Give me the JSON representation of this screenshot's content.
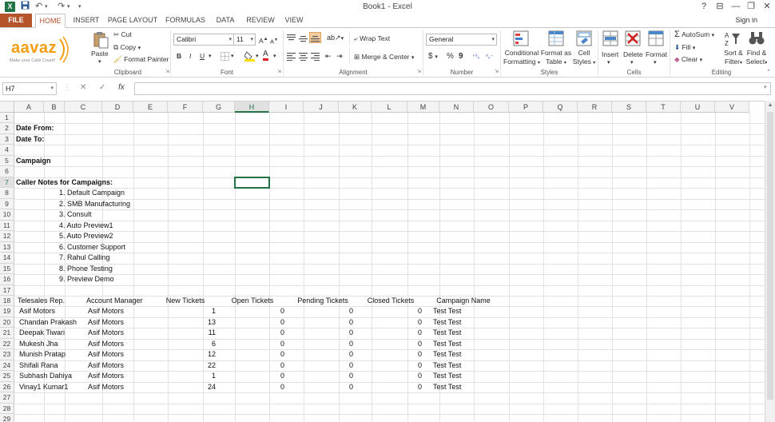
{
  "title_bar": {
    "app_logo": "X",
    "title": "Book1 - Excel",
    "help": "?",
    "restore_ribbon": "⊟",
    "minimize": "—",
    "maximize": "❐",
    "close": "✕"
  },
  "tabs": {
    "file": "FILE",
    "items": [
      "HOME",
      "INSERT",
      "PAGE LAYOUT",
      "FORMULAS",
      "DATA",
      "REVIEW",
      "VIEW"
    ],
    "active": "HOME",
    "sign_in": "Sign in"
  },
  "brand": {
    "logo_text": "aavaz",
    "tagline": "Make your Calls Count!"
  },
  "clipboard": {
    "paste": "Paste",
    "cut": "Cut",
    "copy": "Copy",
    "format_painter": "Format Painter",
    "group_label": "Clipboard"
  },
  "font": {
    "font_name": "Calibri",
    "font_size": "11",
    "bold": "B",
    "italic": "I",
    "underline": "U",
    "group_label": "Font"
  },
  "alignment": {
    "wrap_text": "Wrap Text",
    "merge_center": "Merge & Center",
    "group_label": "Alignment"
  },
  "number": {
    "format": "General",
    "currency": "$",
    "percent": "%",
    "comma": "9",
    "group_label": "Number"
  },
  "styles": {
    "conditional_formatting": [
      "Conditional",
      "Formatting"
    ],
    "format_as_table": [
      "Format as",
      "Table"
    ],
    "cell_styles": [
      "Cell",
      "Styles"
    ],
    "group_label": "Styles"
  },
  "cells": {
    "insert": "Insert",
    "delete": "Delete",
    "format": "Format",
    "group_label": "Cells"
  },
  "editing": {
    "autosum": "AutoSum",
    "fill": "Fill",
    "clear": "Clear",
    "sort_filter": [
      "Sort &",
      "Filter"
    ],
    "find_select": [
      "Find &",
      "Select"
    ],
    "group_label": "Editing"
  },
  "formula_bar": {
    "name_box": "H7",
    "cancel": "✕",
    "enter": "✓",
    "fx": "fx",
    "value": ""
  },
  "sheet": {
    "columns": [
      "A",
      "B",
      "C",
      "D",
      "E",
      "F",
      "G",
      "H",
      "I",
      "J",
      "K",
      "L",
      "M",
      "N",
      "O",
      "P",
      "Q",
      "R",
      "S",
      "T",
      "U",
      "V"
    ],
    "selected_column": "H",
    "row_numbers": [
      "1",
      "2",
      "3",
      "4",
      "5",
      "6",
      "7",
      "8",
      "9",
      "10",
      "11",
      "12",
      "13",
      "14",
      "15",
      "16",
      "17",
      "18",
      "19",
      "20",
      "21",
      "22",
      "23",
      "24",
      "25",
      "26",
      "27",
      "28",
      "29"
    ],
    "selected_row": "7",
    "header_block": {
      "date_from": "Date From:",
      "date_to": "Date To:",
      "campaign": "Campaign",
      "caller_notes": "Caller Notes for Campaigns:"
    },
    "campaigns": [
      "1. Default Campaign",
      "2. SMB Manufacturing",
      "3. Consult",
      "4. Auto Preview1",
      "5. Auto Preview2",
      "6. Customer Support",
      "7. Rahul Calling",
      "8. Phone Testing",
      "9. Preview Demo"
    ],
    "table_headers": [
      "Telesales Rep.",
      "Account Manager",
      "New Tickets",
      "Open Tickets",
      "Pending Tickets",
      "Closed Tickets",
      "Campaign Name"
    ],
    "table_rows": [
      [
        "Asif Motors",
        "Asif Motors",
        "1",
        "0",
        "0",
        "0",
        "Test Test"
      ],
      [
        "Chandan Prakash",
        "Asif Motors",
        "13",
        "0",
        "0",
        "0",
        "Test Test"
      ],
      [
        "Deepak Tiwari",
        "Asif Motors",
        "11",
        "0",
        "0",
        "0",
        "Test Test"
      ],
      [
        "Mukesh Jha",
        "Asif Motors",
        "6",
        "0",
        "0",
        "0",
        "Test Test"
      ],
      [
        "Munish Pratap",
        "Asif Motors",
        "12",
        "0",
        "0",
        "0",
        "Test Test"
      ],
      [
        "Shifali Rana",
        "Asif Motors",
        "22",
        "0",
        "0",
        "0",
        "Test Test"
      ],
      [
        "Subhash Dahiya",
        "Asif Motors",
        "1",
        "0",
        "0",
        "0",
        "Test Test"
      ],
      [
        "Vinay1 Kumar1",
        "Asif Motors",
        "24",
        "0",
        "0",
        "0",
        "Test Test"
      ]
    ]
  },
  "colors": {
    "excel_green": "#217346",
    "file_tab": "#b5532b",
    "brand_orange": "#f39c12",
    "brand_gray": "#888888"
  }
}
